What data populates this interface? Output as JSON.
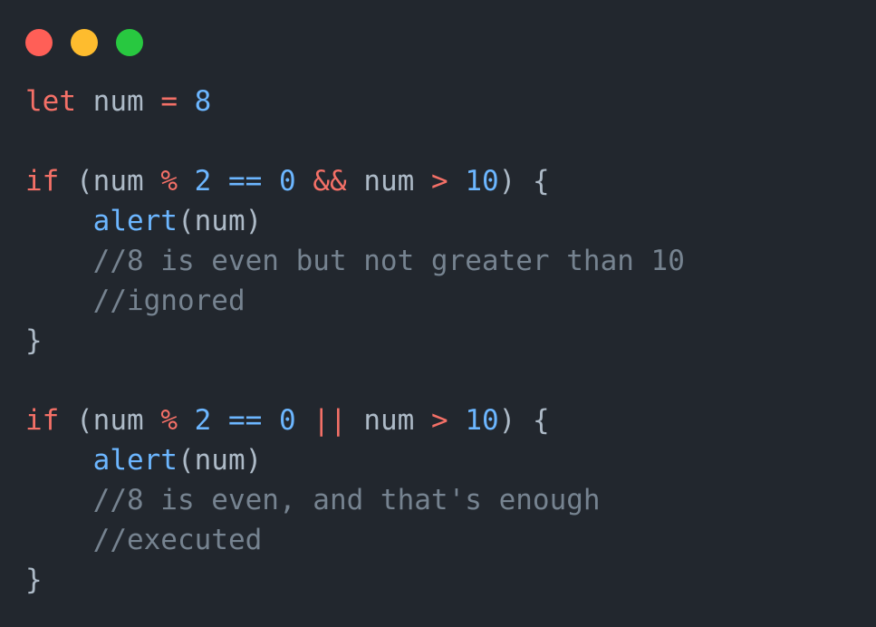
{
  "window": {
    "controls": [
      {
        "name": "close",
        "color": "#ff5f57"
      },
      {
        "name": "minimize",
        "color": "#febc2e"
      },
      {
        "name": "maximize",
        "color": "#28c840"
      }
    ]
  },
  "theme": {
    "background": "#22272e",
    "keyword": "#f47067",
    "number": "#6cb6ff",
    "function": "#6cb6ff",
    "comment": "#768390",
    "plain": "#adbac7"
  },
  "code": {
    "lines": [
      [
        {
          "t": "keyword",
          "v": "let"
        },
        {
          "t": "plain",
          "v": " num "
        },
        {
          "t": "operator",
          "v": "="
        },
        {
          "t": "plain",
          "v": " "
        },
        {
          "t": "number",
          "v": "8"
        }
      ],
      [],
      [
        {
          "t": "keyword",
          "v": "if"
        },
        {
          "t": "plain",
          "v": " (num "
        },
        {
          "t": "operator",
          "v": "%"
        },
        {
          "t": "plain",
          "v": " "
        },
        {
          "t": "number",
          "v": "2"
        },
        {
          "t": "plain",
          "v": " "
        },
        {
          "t": "number",
          "v": "=="
        },
        {
          "t": "plain",
          "v": " "
        },
        {
          "t": "number",
          "v": "0"
        },
        {
          "t": "plain",
          "v": " "
        },
        {
          "t": "operator",
          "v": "&&"
        },
        {
          "t": "plain",
          "v": " num "
        },
        {
          "t": "operator",
          "v": ">"
        },
        {
          "t": "plain",
          "v": " "
        },
        {
          "t": "number",
          "v": "10"
        },
        {
          "t": "plain",
          "v": ") {"
        }
      ],
      [
        {
          "t": "plain",
          "v": "    "
        },
        {
          "t": "function",
          "v": "alert"
        },
        {
          "t": "plain",
          "v": "(num)"
        }
      ],
      [
        {
          "t": "plain",
          "v": "    "
        },
        {
          "t": "comment",
          "v": "//8 is even but not greater than 10"
        }
      ],
      [
        {
          "t": "plain",
          "v": "    "
        },
        {
          "t": "comment",
          "v": "//ignored"
        }
      ],
      [
        {
          "t": "plain",
          "v": "}"
        }
      ],
      [],
      [
        {
          "t": "keyword",
          "v": "if"
        },
        {
          "t": "plain",
          "v": " (num "
        },
        {
          "t": "operator",
          "v": "%"
        },
        {
          "t": "plain",
          "v": " "
        },
        {
          "t": "number",
          "v": "2"
        },
        {
          "t": "plain",
          "v": " "
        },
        {
          "t": "number",
          "v": "=="
        },
        {
          "t": "plain",
          "v": " "
        },
        {
          "t": "number",
          "v": "0"
        },
        {
          "t": "plain",
          "v": " "
        },
        {
          "t": "operator",
          "v": "||"
        },
        {
          "t": "plain",
          "v": " num "
        },
        {
          "t": "operator",
          "v": ">"
        },
        {
          "t": "plain",
          "v": " "
        },
        {
          "t": "number",
          "v": "10"
        },
        {
          "t": "plain",
          "v": ") {"
        }
      ],
      [
        {
          "t": "plain",
          "v": "    "
        },
        {
          "t": "function",
          "v": "alert"
        },
        {
          "t": "plain",
          "v": "(num)"
        }
      ],
      [
        {
          "t": "plain",
          "v": "    "
        },
        {
          "t": "comment",
          "v": "//8 is even, and that's enough"
        }
      ],
      [
        {
          "t": "plain",
          "v": "    "
        },
        {
          "t": "comment",
          "v": "//executed"
        }
      ],
      [
        {
          "t": "plain",
          "v": "}"
        }
      ]
    ]
  }
}
